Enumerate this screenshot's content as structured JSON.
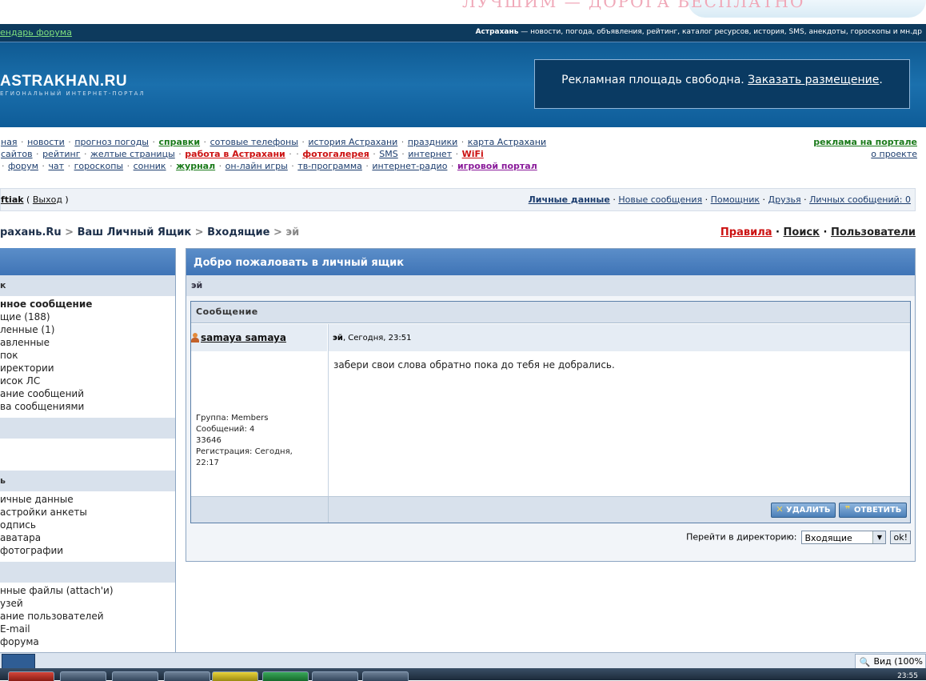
{
  "top": {
    "slogan": "ЛУЧШИМ — ДОРОГА БЕСПЛАТНО"
  },
  "darkbar": {
    "calendar_link": "ендарь форума",
    "site_name": "Астрахань",
    "description": " — новости, погода, объявления, рейтинг, каталог ресурсов, история, SMS, анекдоты, гороскопы и мн.др"
  },
  "header": {
    "logo": "ASTRAKHAN.RU",
    "logo_sub": "ЕГИОНАЛЬНЫЙ ИНТЕРНЕТ-ПОРТАЛ",
    "ad_text": "Рекламная площадь свободна. ",
    "ad_link": "Заказать размещение",
    "ad_dot": "."
  },
  "nav": {
    "row1": [
      {
        "label": "ная",
        "style": ""
      },
      {
        "label": "новости",
        "style": ""
      },
      {
        "label": "прогноз погоды",
        "style": ""
      },
      {
        "label": "справки",
        "style": "g"
      },
      {
        "label": "сотовые телефоны",
        "style": ""
      },
      {
        "label": "история Астрахани",
        "style": ""
      },
      {
        "label": "праздники",
        "style": ""
      },
      {
        "label": "карта Астрахани",
        "style": ""
      }
    ],
    "row2": [
      {
        "label": " сайтов",
        "style": ""
      },
      {
        "label": "рейтинг",
        "style": ""
      },
      {
        "label": "желтые страницы",
        "style": ""
      },
      {
        "label": "работа в Астрахани",
        "style": "r"
      },
      {
        "label": "",
        "style": ""
      },
      {
        "label": "фотогалерея",
        "style": "r"
      },
      {
        "label": "SMS",
        "style": ""
      },
      {
        "label": "интернет",
        "style": ""
      },
      {
        "label": "WiFi",
        "style": "r"
      }
    ],
    "row3": [
      {
        "label": "",
        "style": ""
      },
      {
        "label": "форум",
        "style": ""
      },
      {
        "label": "чат",
        "style": ""
      },
      {
        "label": "гороскопы",
        "style": ""
      },
      {
        "label": "сонник",
        "style": ""
      },
      {
        "label": "журнал",
        "style": "g"
      },
      {
        "label": "он-лайн игры",
        "style": ""
      },
      {
        "label": "тв-программа",
        "style": ""
      },
      {
        "label": "интернет-радио",
        "style": ""
      },
      {
        "label": "игровой портал",
        "style": "p"
      }
    ],
    "ads_link": "реклама на портале",
    "about_link": "о проекте"
  },
  "userbar": {
    "username": "ftiak",
    "logout_open": " ( ",
    "logout": "Выход",
    "logout_close": " )",
    "links": [
      "Личные данные",
      "Новые сообщения",
      "Помощник",
      "Друзья",
      "Личных сообщений: 0"
    ]
  },
  "breadcrumb": {
    "root": "рахань.Ru",
    "sep": " > ",
    "mailbox": "Ваш Личный Ящик",
    "inbox": "Входящие",
    "current": "эй"
  },
  "toplinks": {
    "rules": "Правила",
    "search": "Поиск",
    "users": "Пользователи",
    "sep": " · "
  },
  "sidebar": {
    "section1": "к",
    "items1": [
      "нное сообщение",
      "щие (188)",
      "ленные (1)",
      "авленные",
      "пок",
      "иректории",
      "исок ЛС",
      "ание сообщений",
      "ва сообщениями"
    ],
    "section3": "ь",
    "items3": [
      "ичные данные",
      "астройки анкеты",
      "одпись",
      "аватара",
      "фотографии"
    ],
    "items4": [
      "нные файлы (attach'и)",
      "узей",
      "ание пользователей",
      "E-mail",
      "форума"
    ]
  },
  "main": {
    "title": "Добро пожаловать в личный ящик",
    "subject_row": "эй",
    "message_header": "Сообщение",
    "author": "samaya samaya",
    "subject": "эй",
    "date": ", Сегодня, 23:51",
    "body": "забери свои слова обратно пока до тебя не добрались.",
    "user_info": [
      "Группа: Members",
      "Сообщений: 4",
      "33646",
      "Регистрация: Сегодня,",
      "22:17"
    ],
    "delete_button": "УДАЛИТЬ",
    "reply_button": "ОТВЕТИТЬ",
    "jump_label": "Перейти в директорию:",
    "jump_value": "Входящие",
    "ok_button": "ok!"
  },
  "statusbar": {
    "zoom": "Вид (100%"
  },
  "taskbar": {
    "clock": "23:55"
  }
}
